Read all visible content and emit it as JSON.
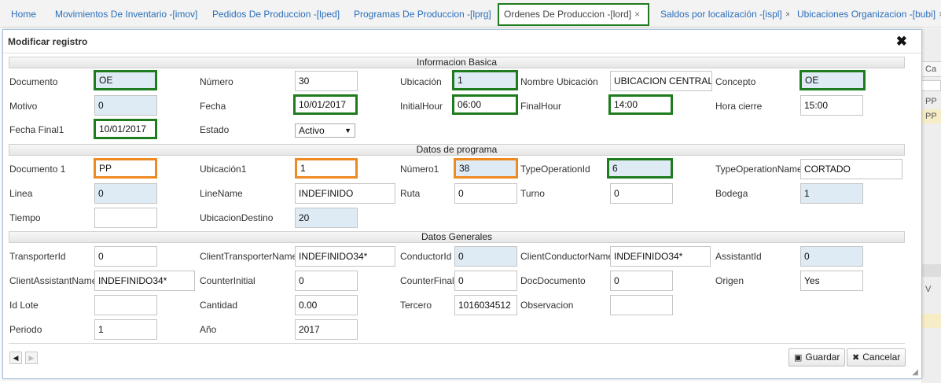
{
  "tabs": [
    {
      "label": "Home",
      "closable": false
    },
    {
      "label": "Movimientos De Inventario -[imov]",
      "closable": true
    },
    {
      "label": "Pedidos De Produccion -[lped]",
      "closable": true
    },
    {
      "label": "Programas De Produccion -[lprg]",
      "closable": true
    },
    {
      "label": "Ordenes De Produccion -[lord]",
      "closable": true,
      "active": true
    },
    {
      "label": "Saldos por localización -[ispl]",
      "closable": true
    },
    {
      "label": "Ubicaciones Organizacion -[bubi]",
      "closable": true
    }
  ],
  "close_glyph": "×",
  "background": {
    "col_header": "Ca",
    "rows": [
      "PP",
      "PP"
    ],
    "v_label": "V"
  },
  "dialog": {
    "title": "Modificar registro",
    "close_glyph": "✖",
    "sections": {
      "basica": "Informacion Basica",
      "programa": "Datos de programa",
      "generales": "Datos Generales"
    },
    "fields": {
      "documento": {
        "label": "Documento",
        "value": "OE"
      },
      "numero": {
        "label": "Número",
        "value": "30"
      },
      "ubicacion": {
        "label": "Ubicación",
        "value": "1"
      },
      "nombre_ubicacion": {
        "label": "Nombre Ubicación",
        "value": "UBICACION CENTRAL"
      },
      "concepto": {
        "label": "Concepto",
        "value": "OE"
      },
      "motivo": {
        "label": "Motivo",
        "value": "0"
      },
      "fecha": {
        "label": "Fecha",
        "value": "10/01/2017"
      },
      "initial_hour": {
        "label": "InitialHour",
        "value": "06:00"
      },
      "final_hour": {
        "label": "FinalHour",
        "value": "14:00"
      },
      "hora_cierre": {
        "label": "Hora cierre",
        "value": "15:00"
      },
      "fecha_final1": {
        "label": "Fecha Final1",
        "value": "10/01/2017"
      },
      "estado": {
        "label": "Estado",
        "value": "Activo"
      },
      "documento1": {
        "label": "Documento 1",
        "value": "PP"
      },
      "ubicacion1": {
        "label": "Ubicación1",
        "value": "1"
      },
      "numero1": {
        "label": "Número1",
        "value": "38"
      },
      "type_operation_id": {
        "label": "TypeOperationId",
        "value": "6"
      },
      "type_operation_name": {
        "label": "TypeOperationName",
        "value": "CORTADO"
      },
      "linea": {
        "label": "Linea",
        "value": "0"
      },
      "line_name": {
        "label": "LineName",
        "value": "INDEFINIDO"
      },
      "ruta": {
        "label": "Ruta",
        "value": "0"
      },
      "turno": {
        "label": "Turno",
        "value": "0"
      },
      "bodega": {
        "label": "Bodega",
        "value": "1"
      },
      "tiempo": {
        "label": "Tiempo",
        "value": ""
      },
      "ubicacion_destino": {
        "label": "UbicacionDestino",
        "value": "20"
      },
      "transporter_id": {
        "label": "TransporterId",
        "value": "0"
      },
      "client_transporter_name": {
        "label": "ClientTransporterName",
        "value": "INDEFINIDO34*"
      },
      "conductor_id": {
        "label": "ConductorId",
        "value": "0"
      },
      "client_conductor_name": {
        "label": "ClientConductorName",
        "value": "INDEFINIDO34*"
      },
      "assistant_id": {
        "label": "AssistantId",
        "value": "0"
      },
      "client_assistant_name": {
        "label": "ClientAssistantName",
        "value": "INDEFINIDO34*"
      },
      "counter_initial": {
        "label": "CounterInitial",
        "value": "0"
      },
      "counter_final": {
        "label": "CounterFinal",
        "value": "0"
      },
      "doc_documento": {
        "label": "DocDocumento",
        "value": "0"
      },
      "origen": {
        "label": "Origen",
        "value": "Yes"
      },
      "id_lote": {
        "label": "Id Lote",
        "value": ""
      },
      "cantidad": {
        "label": "Cantidad",
        "value": "0.00"
      },
      "tercero": {
        "label": "Tercero",
        "value": "1016034512"
      },
      "observacion": {
        "label": "Observacion",
        "value": ""
      },
      "periodo": {
        "label": "Periodo",
        "value": "1"
      },
      "anio": {
        "label": "Año",
        "value": "2017"
      }
    },
    "nav": {
      "prev": "◀",
      "next": "▶"
    },
    "buttons": {
      "guardar": "Guardar",
      "cancelar": "Cancelar"
    },
    "icons": {
      "save": "▣",
      "cancel": "✖",
      "grip": "◢"
    }
  },
  "highlight_colors": {
    "green": "#1e7b1e",
    "orange": "#ee8a22",
    "readonly_bg": "#deebf5"
  }
}
